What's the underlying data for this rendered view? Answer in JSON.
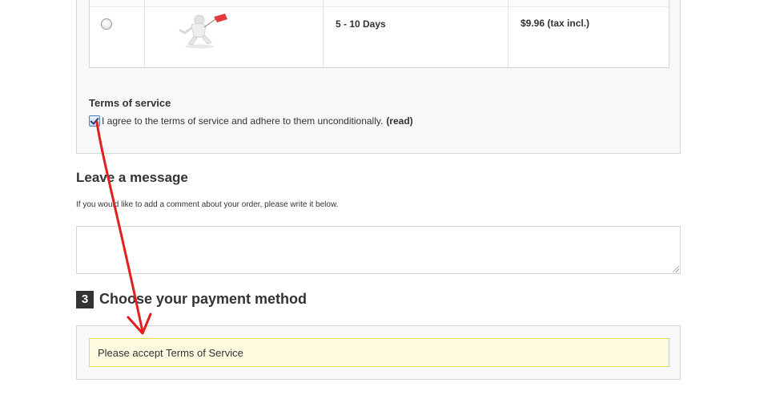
{
  "carrier": {
    "delay": "5 - 10 Days",
    "price": "$9.96 (tax incl.)"
  },
  "terms": {
    "title": "Terms of service",
    "agree_text": "I agree to the terms of service and adhere to them unconditionally.",
    "read_link": "(read)",
    "checked": true
  },
  "message": {
    "title": "Leave a message",
    "help_text": "If you would like to add a comment about your order, please write it below.",
    "value": ""
  },
  "payment": {
    "step_number": "3",
    "title": "Choose your payment method",
    "warning": "Please accept Terms of Service"
  },
  "annotation": {
    "color": "#e02020"
  }
}
